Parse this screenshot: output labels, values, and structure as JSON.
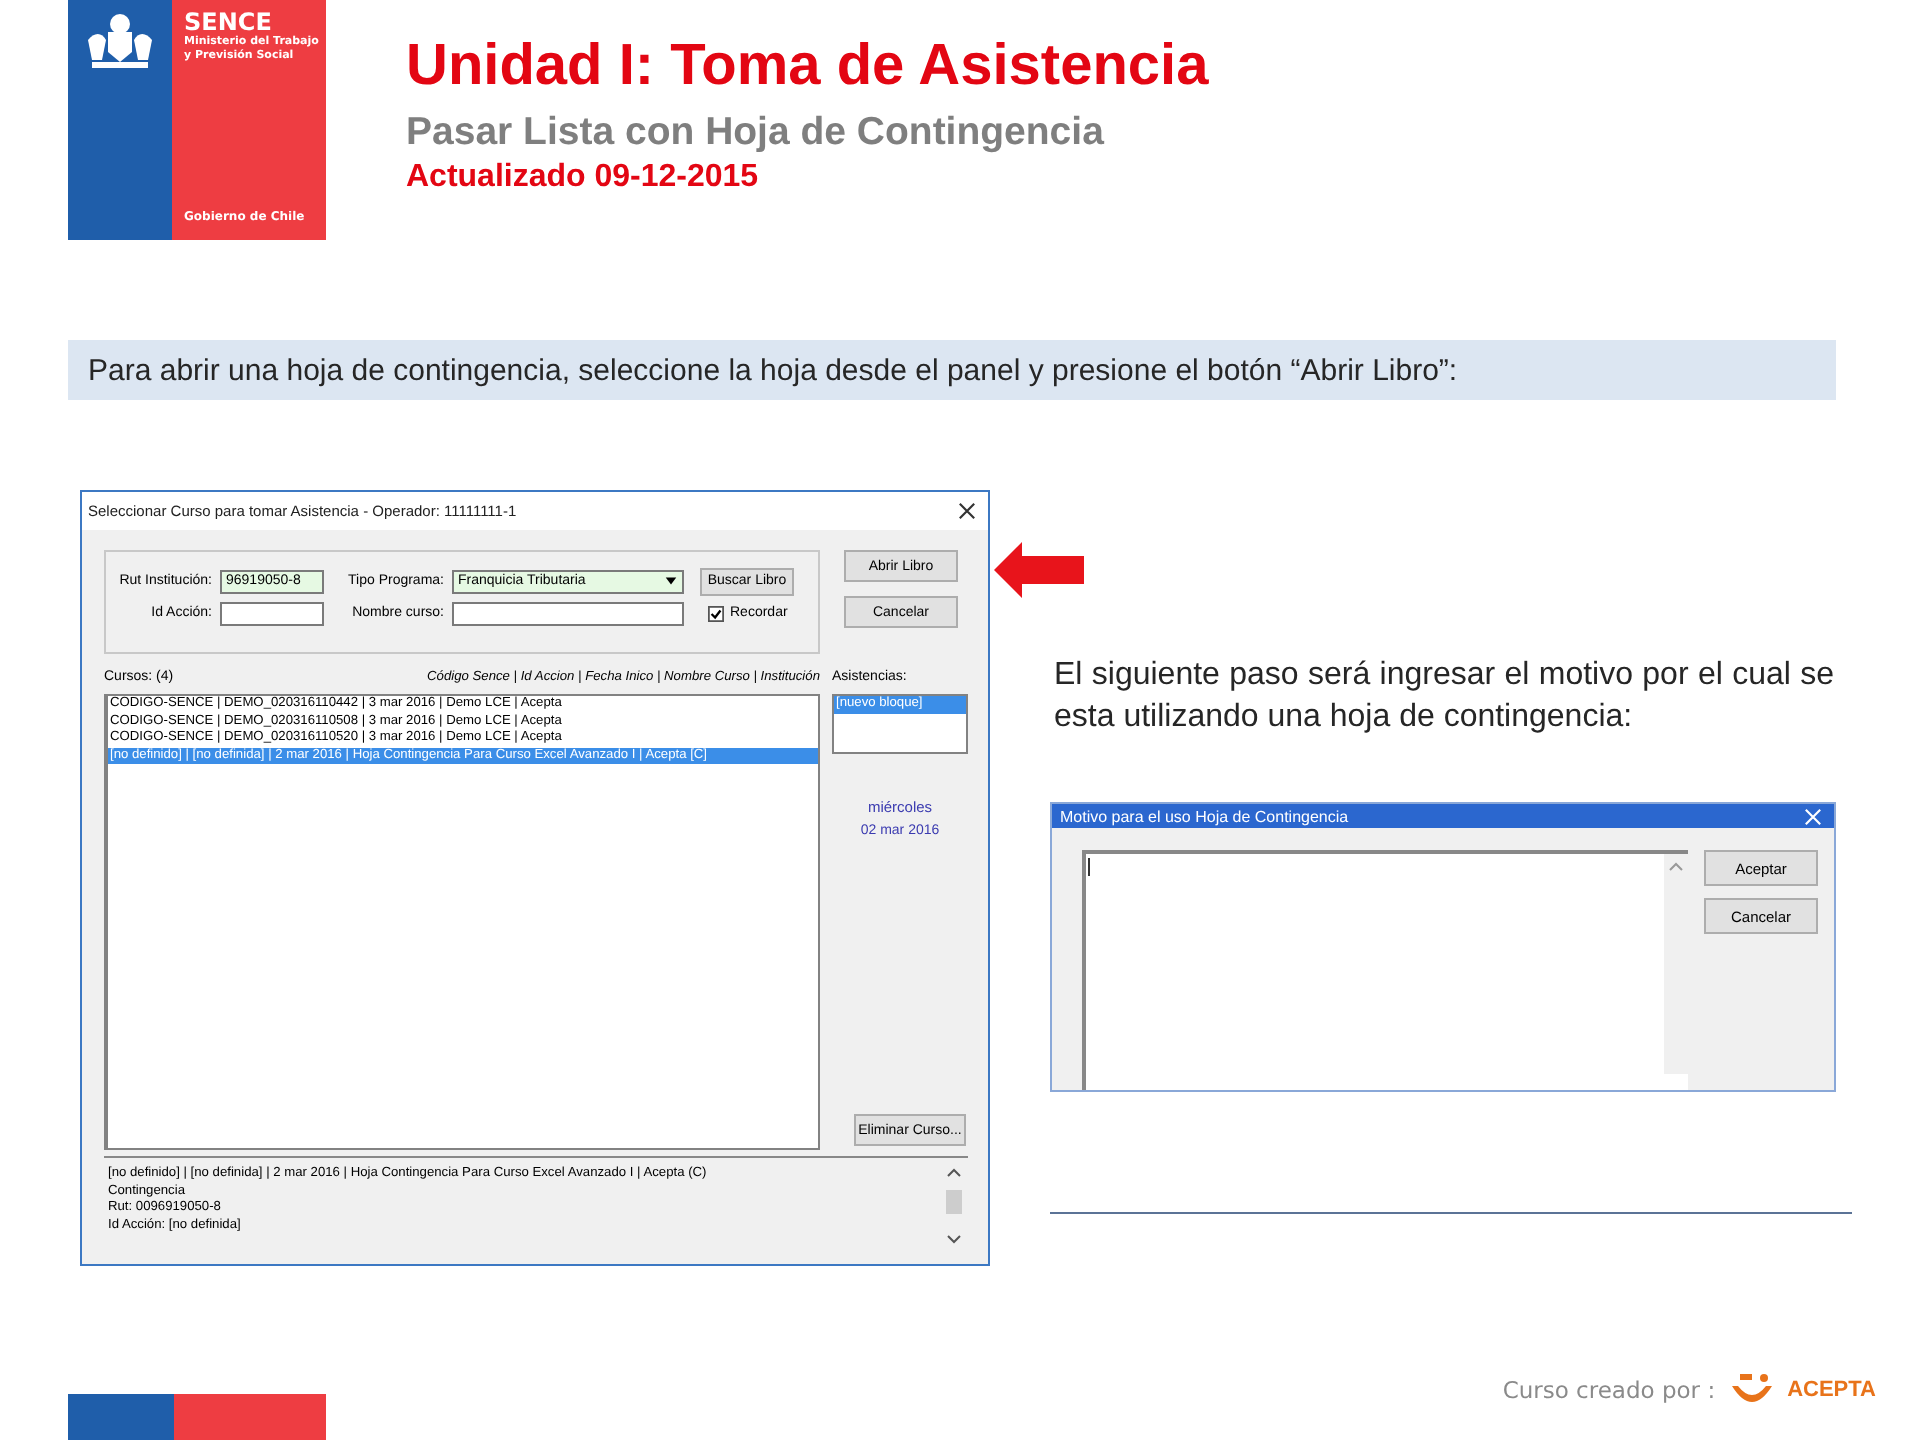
{
  "logo": {
    "name": "SENCE",
    "ministry": "Ministerio del Trabajo",
    "ministry_2": "y Previsión Social",
    "government": "Gobierno de Chile"
  },
  "title": "Unidad I: Toma de Asistencia",
  "subtitle": "Pasar Lista con Hoja de Contingencia",
  "updated": "Actualizado 09-12-2015",
  "instruction": "Para abrir una hoja de contingencia, seleccione la hoja desde el panel y presione el botón “Abrir Libro”:",
  "course_dialog": {
    "title": "Seleccionar Curso para tomar Asistencia - Operador: 11111111-1",
    "rut_label": "Rut Institución:",
    "rut_value": "96919050-8",
    "program_label": "Tipo Programa:",
    "program_value": "Franquicia Tributaria",
    "action_label": "Id Acción:",
    "course_name_label": "Nombre curso:",
    "search_button": "Buscar Libro",
    "remember": {
      "label": "Recordar",
      "checked": true
    },
    "buttons": [
      "Abrir Libro",
      "Cancelar"
    ],
    "courses_label": "Cursos: (4)",
    "columns_header": "Código Sence | Id Accion | Fecha Inico | Nombre Curso | Institución",
    "courses": [
      {
        "text": "CODIGO-SENCE | DEMO_020316110442 | 3 mar 2016 | Demo LCE | Acepta",
        "selected": false
      },
      {
        "text": "CODIGO-SENCE | DEMO_020316110508 | 3 mar 2016 | Demo LCE | Acepta",
        "selected": false
      },
      {
        "text": "CODIGO-SENCE | DEMO_020316110520 | 3 mar 2016 | Demo LCE | Acepta",
        "selected": false
      },
      {
        "text": "[no definido] | [no definida] | 2 mar 2016 | Hoja Contingencia Para Curso Excel Avanzado I | Acepta [C]",
        "selected": true
      }
    ],
    "attendance_label": "Asistencias:",
    "attendance": [
      {
        "text": "[nuevo bloque]",
        "selected": true
      }
    ],
    "day": "miércoles",
    "date": "02 mar 2016",
    "delete_button": "Eliminar Curso...",
    "details": [
      "[no definido] | [no definida] | 2 mar 2016 | Hoja Contingencia Para Curso Excel Avanzado I | Acepta (C)",
      "Contingencia",
      "Rut: 0096919050-8",
      "Id Acción: [no definida]"
    ]
  },
  "next_step": "El siguiente paso será ingresar el motivo por el cual se esta utilizando una hoja de contingencia:",
  "reason_dialog": {
    "title": "Motivo para el uso Hoja de Contingencia",
    "buttons": [
      "Aceptar",
      "Cancelar"
    ]
  },
  "footer": {
    "credit": "Curso creado por :",
    "brand": "ACEPTA"
  }
}
